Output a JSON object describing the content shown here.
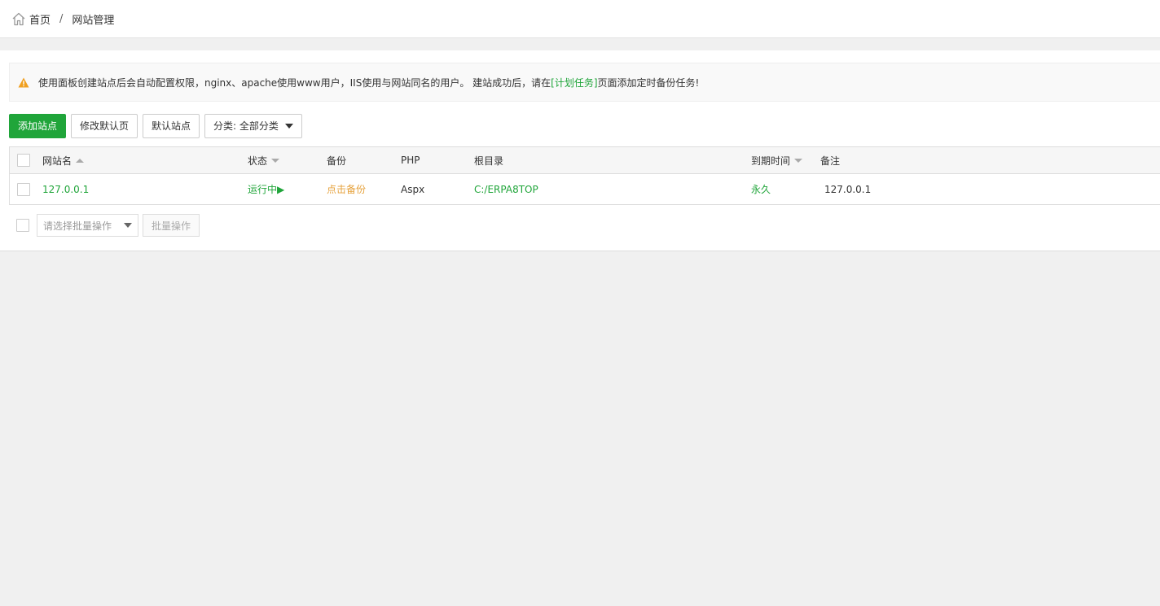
{
  "breadcrumb": {
    "home": "首页",
    "separator": "/",
    "current": "网站管理"
  },
  "notice": {
    "text_before": "使用面板创建站点后会自动配置权限，nginx、apache使用www用户，IIS使用与网站同名的用户。 建站成功后，请在",
    "link": "[计划任务]",
    "text_after": "页面添加定时备份任务!",
    "icon": "warning-icon"
  },
  "toolbar": {
    "add_site": "添加站点",
    "modify_default": "修改默认页",
    "default_site": "默认站点",
    "category": "分类: 全部分类"
  },
  "table": {
    "headers": {
      "name": "网站名",
      "status": "状态",
      "backup": "备份",
      "php": "PHP",
      "root": "根目录",
      "expire": "到期时间",
      "note": "备注"
    },
    "rows": [
      {
        "name": "127.0.0.1",
        "status": "运行中▶",
        "backup": "点击备份",
        "php": "Aspx",
        "root": "C:/ERPA8TOP",
        "expire": "永久",
        "note": "127.0.0.1"
      }
    ]
  },
  "batch": {
    "placeholder": "请选择批量操作",
    "button": "批量操作"
  },
  "colors": {
    "accent": "#20a53a",
    "warning": "#f0a020",
    "backup": "#e6a23c"
  }
}
